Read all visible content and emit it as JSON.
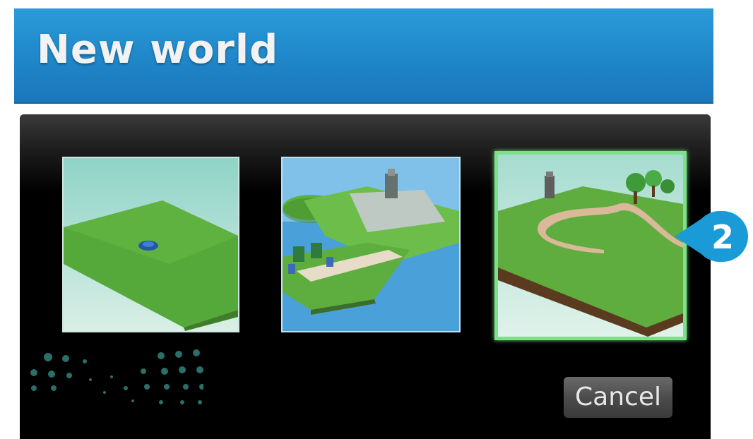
{
  "dialog": {
    "title": "New world",
    "cancel_label": "Cancel"
  },
  "templates": [
    {
      "name": "flat-terrain",
      "selected": false
    },
    {
      "name": "island-village",
      "selected": false
    },
    {
      "name": "hills-path",
      "selected": true
    }
  ],
  "callout": {
    "label": "2",
    "color": "#1a9bd7"
  },
  "colors": {
    "title_bar": "#1f86c9",
    "body_background": "#000000",
    "selection_border": "#7fe08a"
  }
}
